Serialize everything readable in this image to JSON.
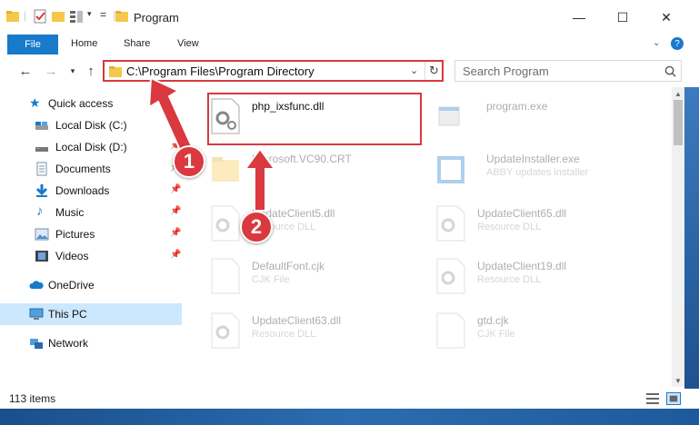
{
  "window": {
    "title": "Program",
    "minimize": "—",
    "maximize": "☐",
    "close": "✕"
  },
  "ribbon": {
    "file": "File",
    "home": "Home",
    "share": "Share",
    "view": "View",
    "help": "?"
  },
  "address": {
    "path": "C:\\Program Files\\Program Directory",
    "search_placeholder": "Search Program"
  },
  "nav": {
    "items": [
      {
        "label": "Quick access",
        "icon": "star-icon",
        "pinned": false
      },
      {
        "label": "Local Disk (C:)",
        "icon": "drive-icon",
        "pinned": false
      },
      {
        "label": "Local Disk (D:)",
        "icon": "drive-icon",
        "pinned": true
      },
      {
        "label": "Documents",
        "icon": "documents-icon",
        "pinned": true
      },
      {
        "label": "Downloads",
        "icon": "download-icon",
        "pinned": true
      },
      {
        "label": "Music",
        "icon": "music-icon",
        "pinned": true
      },
      {
        "label": "Pictures",
        "icon": "pictures-icon",
        "pinned": true
      },
      {
        "label": "Videos",
        "icon": "videos-icon",
        "pinned": true
      },
      {
        "label": "OneDrive",
        "icon": "cloud-icon",
        "pinned": false
      },
      {
        "label": "This PC",
        "icon": "computer-icon",
        "pinned": false,
        "selected": true
      },
      {
        "label": "Network",
        "icon": "network-icon",
        "pinned": false
      }
    ]
  },
  "files": [
    {
      "name": "php_ixsfunc.dll",
      "type": "",
      "icon": "dll-gear-icon",
      "highlighted": true
    },
    {
      "name": "program.exe",
      "type": "",
      "icon": "exe-icon"
    },
    {
      "name": "Microsoft.VC90.CRT",
      "type": "",
      "icon": "folder-icon"
    },
    {
      "name": "UpdateInstaller.exe",
      "type": "ABBY updates installer",
      "icon": "installer-icon"
    },
    {
      "name": "UpdateClient5.dll",
      "type": "Resource DLL",
      "icon": "dll-gear-icon"
    },
    {
      "name": "UpdateClient65.dll",
      "type": "Resource DLL",
      "icon": "dll-gear-icon"
    },
    {
      "name": "DefaultFont.cjk",
      "type": "CJK File",
      "icon": "blank-file-icon"
    },
    {
      "name": "UpdateClient19.dll",
      "type": "Resource DLL",
      "icon": "dll-gear-icon"
    },
    {
      "name": "UpdateClient63.dll",
      "type": "Resource DLL",
      "icon": "dll-gear-icon"
    },
    {
      "name": "gtd.cjk",
      "type": "CJK File",
      "icon": "blank-file-icon"
    }
  ],
  "annotations": {
    "step1": "1",
    "step2": "2"
  },
  "status": {
    "count": "113 items"
  },
  "colors": {
    "accent": "#1979ca",
    "highlight": "#d9393f",
    "selection": "#cce8ff"
  }
}
